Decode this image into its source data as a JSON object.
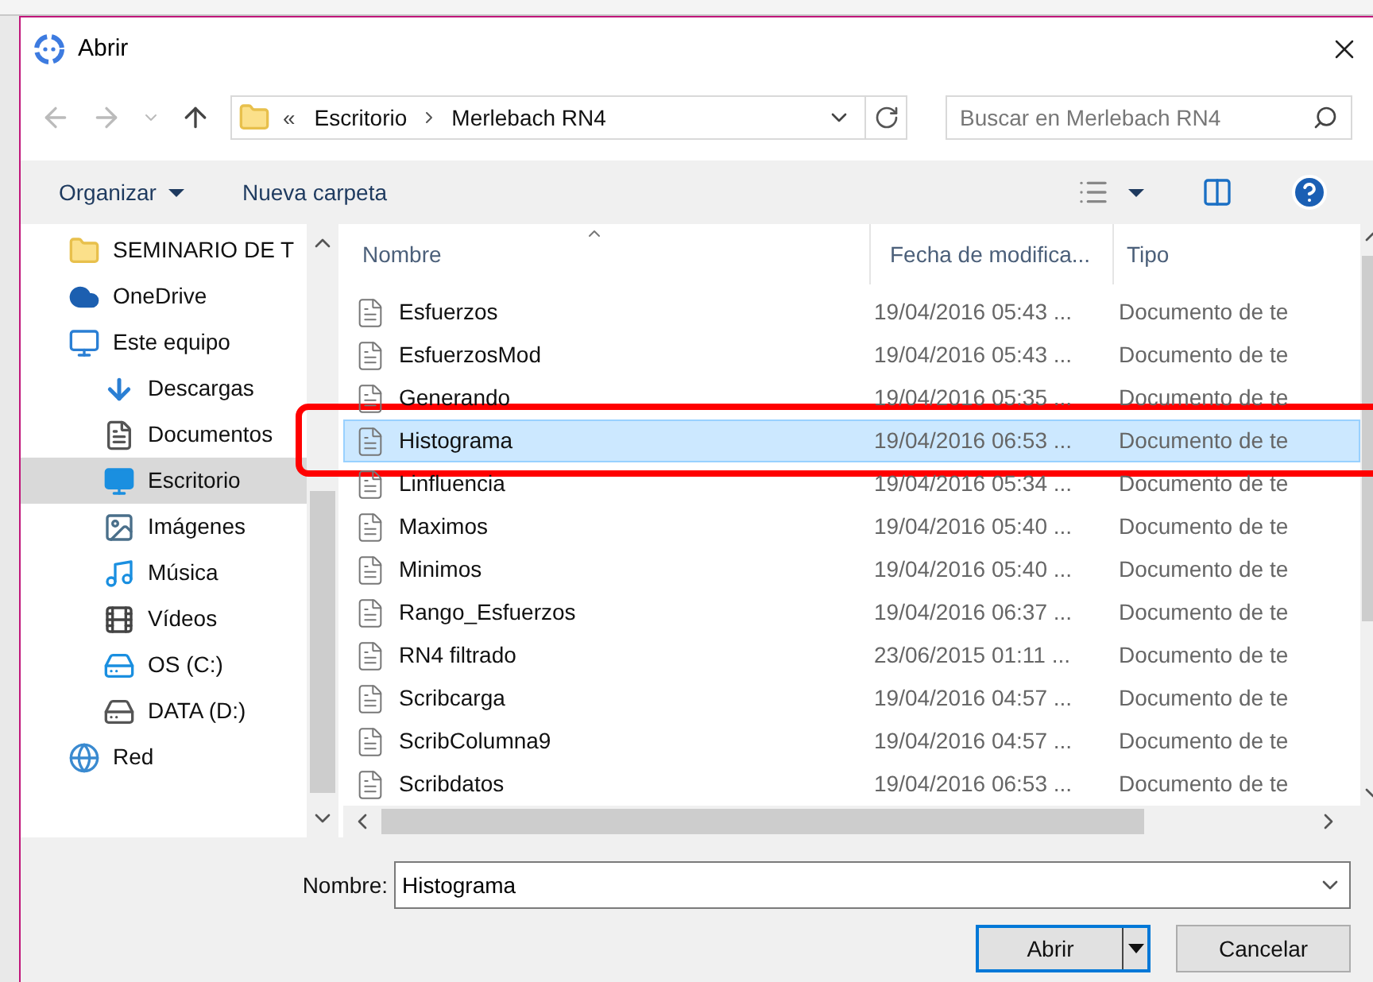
{
  "window": {
    "title": "Abrir"
  },
  "address": {
    "path": [
      "Escritorio",
      "Merlebach RN4"
    ],
    "overflow": "«"
  },
  "search": {
    "placeholder": "Buscar en Merlebach RN4"
  },
  "toolbar": {
    "organize": "Organizar",
    "new_folder": "Nueva carpeta"
  },
  "sidebar": {
    "items": [
      {
        "label": "SEMINARIO DE T",
        "kind": "folder",
        "selected": false
      },
      {
        "label": "OneDrive",
        "kind": "cloud",
        "selected": false
      },
      {
        "label": "Este equipo",
        "kind": "pc",
        "selected": false,
        "children": [
          {
            "label": "Descargas",
            "kind": "downloads",
            "selected": false
          },
          {
            "label": "Documentos",
            "kind": "documents",
            "selected": false
          },
          {
            "label": "Escritorio",
            "kind": "desktop",
            "selected": true
          },
          {
            "label": "Imágenes",
            "kind": "pictures",
            "selected": false
          },
          {
            "label": "Música",
            "kind": "music",
            "selected": false
          },
          {
            "label": "Vídeos",
            "kind": "videos",
            "selected": false
          },
          {
            "label": "OS (C:)",
            "kind": "os-drive",
            "selected": false
          },
          {
            "label": "DATA (D:)",
            "kind": "drive",
            "selected": false
          }
        ]
      },
      {
        "label": "Red",
        "kind": "network",
        "selected": false
      }
    ]
  },
  "table": {
    "columns": [
      "Nombre",
      "Fecha de modifica...",
      "Tipo"
    ],
    "rows": [
      {
        "name": "Esfuerzos",
        "date": "19/04/2016 05:43 ...",
        "type": "Documento de te",
        "selected": false
      },
      {
        "name": "EsfuerzosMod",
        "date": "19/04/2016 05:43 ...",
        "type": "Documento de te",
        "selected": false
      },
      {
        "name": "Generando",
        "date": "19/04/2016 05:35 ...",
        "type": "Documento de te",
        "selected": false
      },
      {
        "name": "Histograma",
        "date": "19/04/2016 06:53 ...",
        "type": "Documento de te",
        "selected": true
      },
      {
        "name": "Linfluencia",
        "date": "19/04/2016 05:34 ...",
        "type": "Documento de te",
        "selected": false
      },
      {
        "name": "Maximos",
        "date": "19/04/2016 05:40 ...",
        "type": "Documento de te",
        "selected": false
      },
      {
        "name": "Minimos",
        "date": "19/04/2016 05:40 ...",
        "type": "Documento de te",
        "selected": false
      },
      {
        "name": "Rango_Esfuerzos",
        "date": "19/04/2016 06:37 ...",
        "type": "Documento de te",
        "selected": false
      },
      {
        "name": "RN4 filtrado",
        "date": "23/06/2015 01:11 ...",
        "type": "Documento de te",
        "selected": false
      },
      {
        "name": "Scribcarga",
        "date": "19/04/2016 04:57 ...",
        "type": "Documento de te",
        "selected": false
      },
      {
        "name": "ScribColumna9",
        "date": "19/04/2016 04:57 ...",
        "type": "Documento de te",
        "selected": false
      },
      {
        "name": "Scribdatos",
        "date": "19/04/2016 06:53 ...",
        "type": "Documento de te",
        "selected": false
      }
    ]
  },
  "filename": {
    "label": "Nombre:",
    "value": "Histograma"
  },
  "buttons": [
    {
      "label": "Abrir",
      "kind": "split",
      "default": true
    },
    {
      "label": "Cancelar",
      "kind": "plain",
      "default": false
    }
  ]
}
